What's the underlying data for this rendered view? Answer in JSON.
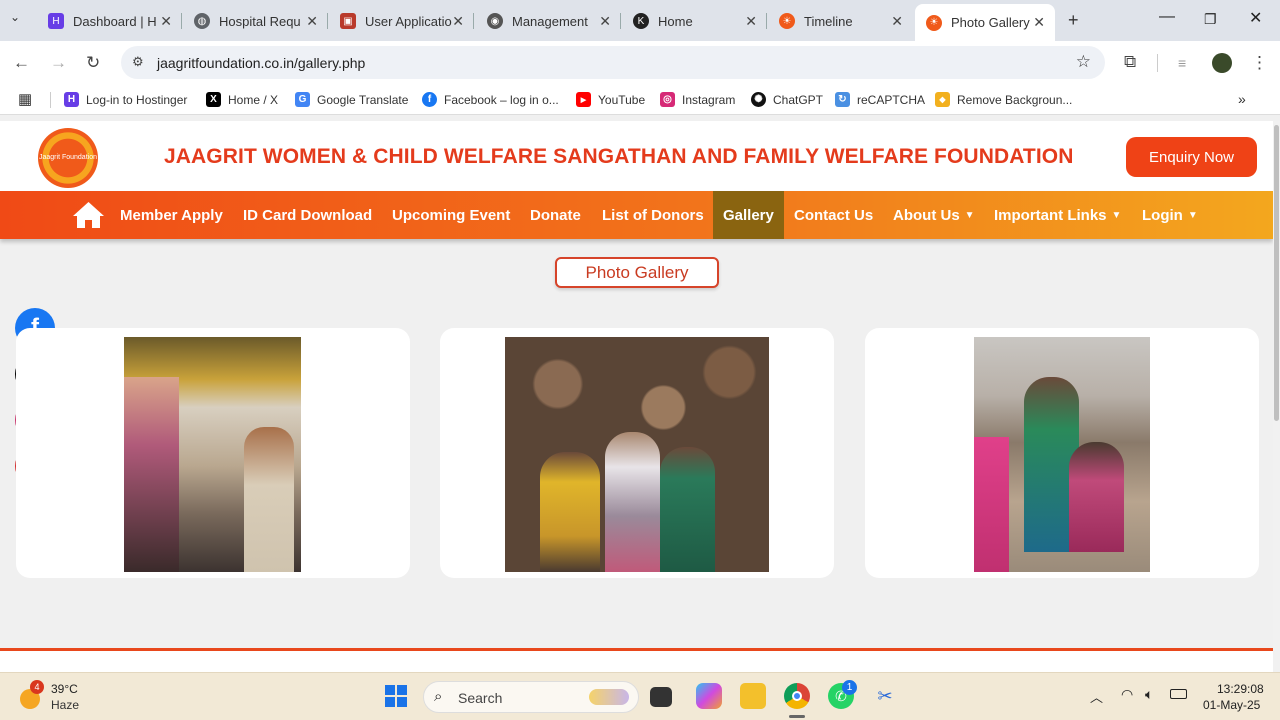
{
  "browser": {
    "tabs": [
      {
        "title": "Dashboard | H",
        "icon": "hostinger-icon",
        "color": "#673de6"
      },
      {
        "title": "Hospital Requ",
        "icon": "globe-icon",
        "color": "#5f6368"
      },
      {
        "title": "User Applicatio",
        "icon": "app-icon",
        "color": "#b93a2b"
      },
      {
        "title": "Management",
        "icon": "owl-icon",
        "color": "#555555"
      },
      {
        "title": "Home",
        "icon": "k-icon",
        "color": "#222222"
      },
      {
        "title": "Timeline",
        "icon": "jaagrit-icon",
        "color": "#f05a1a"
      },
      {
        "title": "Photo Gallery",
        "icon": "jaagrit-icon",
        "color": "#f05a1a",
        "active": true
      }
    ],
    "url": "jaagritfoundation.co.in/gallery.php",
    "bookmarks": [
      {
        "label": "Log-in to Hostinger",
        "color": "#673de6",
        "glyph": "H"
      },
      {
        "label": "Home / X",
        "color": "#000000",
        "glyph": "X"
      },
      {
        "label": "Google Translate",
        "color": "#4285f4",
        "glyph": "G"
      },
      {
        "label": "Facebook – log in o...",
        "color": "#1877f2",
        "glyph": "f"
      },
      {
        "label": "YouTube",
        "color": "#ff0000",
        "glyph": "▶"
      },
      {
        "label": "Instagram",
        "color": "#d62976",
        "glyph": "◎"
      },
      {
        "label": "ChatGPT",
        "color": "#111111",
        "glyph": "✺"
      },
      {
        "label": "reCAPTCHA",
        "color": "#4a90e2",
        "glyph": "↻"
      },
      {
        "label": "Remove Backgroun...",
        "color": "#f2b01e",
        "glyph": "◆"
      }
    ]
  },
  "site": {
    "title": "JAAGRIT WOMEN & CHILD WELFARE SANGATHAN AND FAMILY WELFARE FOUNDATION",
    "logo_text": "Jaagrit Foundation",
    "enquiry_label": "Enquiry Now",
    "nav": [
      {
        "label": "Member Apply"
      },
      {
        "label": "ID Card Download"
      },
      {
        "label": "Upcoming Event"
      },
      {
        "label": "Donate"
      },
      {
        "label": "List of Donors"
      },
      {
        "label": "Gallery",
        "active": true
      },
      {
        "label": "Contact Us"
      },
      {
        "label": "About Us",
        "dropdown": true
      },
      {
        "label": "Important Links",
        "dropdown": true
      },
      {
        "label": "Login",
        "dropdown": true
      }
    ],
    "gallery_heading": "Photo Gallery",
    "social": [
      {
        "name": "facebook",
        "color": "#1877f2",
        "glyph": "f"
      },
      {
        "name": "x",
        "color": "#000000",
        "glyph": "𝕏"
      },
      {
        "name": "instagram",
        "color": "#c8336b",
        "glyph": "◎"
      },
      {
        "name": "youtube",
        "color": "#d32f2f",
        "glyph": "You\nTube"
      }
    ]
  },
  "taskbar": {
    "weather_badge": "4",
    "temperature": "39°C",
    "condition": "Haze",
    "search_label": "Search",
    "whatsapp_badge": "1",
    "time": "13:29:08",
    "date": "01-May-25"
  }
}
